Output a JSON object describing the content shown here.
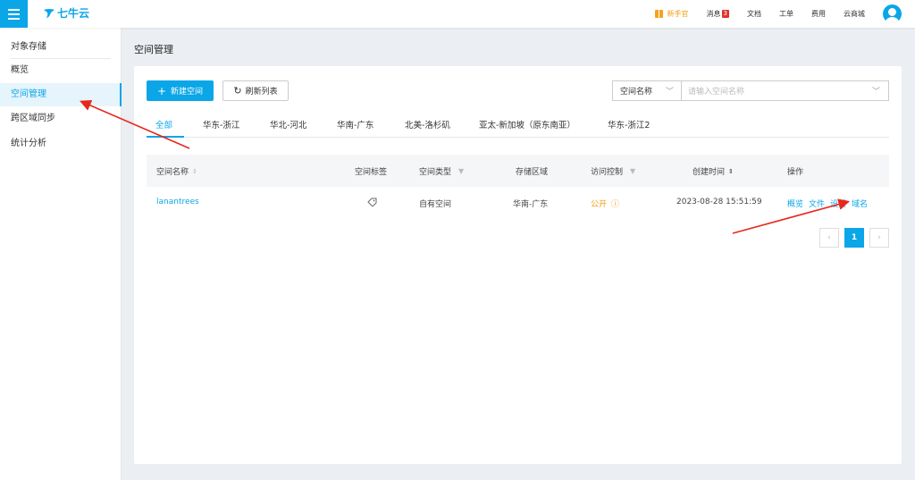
{
  "brand": {
    "logo_text": "七牛云"
  },
  "topnav": {
    "newcomer": "新手官",
    "messages": "消息",
    "messages_badge": "3",
    "docs": "文档",
    "tickets": "工单",
    "billing": "费用",
    "mall": "云商城"
  },
  "sidebar": {
    "title": "对象存储",
    "items": [
      {
        "label": "概览"
      },
      {
        "label": "空间管理"
      },
      {
        "label": "跨区域同步"
      },
      {
        "label": "统计分析"
      }
    ]
  },
  "page": {
    "title": "空间管理"
  },
  "toolbar": {
    "new_label": "新建空间",
    "refresh_label": "刷新列表",
    "search_field": "空间名称",
    "search_placeholder": "请输入空间名称"
  },
  "tabs": [
    {
      "label": "全部"
    },
    {
      "label": "华东-浙江"
    },
    {
      "label": "华北-河北"
    },
    {
      "label": "华南-广东"
    },
    {
      "label": "北美-洛杉矶"
    },
    {
      "label": "亚太-新加坡（原东南亚）"
    },
    {
      "label": "华东-浙江2"
    }
  ],
  "table": {
    "columns": [
      "空间名称",
      "空间标签",
      "空间类型",
      "存储区域",
      "访问控制",
      "创建时间",
      "操作"
    ],
    "rows": [
      {
        "name": "lanantrees",
        "type": "自有空间",
        "region": "华南-广东",
        "access": "公开",
        "created": "2023-08-28 15:51:59",
        "ops": [
          "概览",
          "文件",
          "设置",
          "域名"
        ]
      }
    ]
  },
  "pagination": {
    "current": "1"
  },
  "colors": {
    "accent": "#0aa6e8",
    "warning": "#f39c12",
    "annotation": "#e8271d"
  }
}
